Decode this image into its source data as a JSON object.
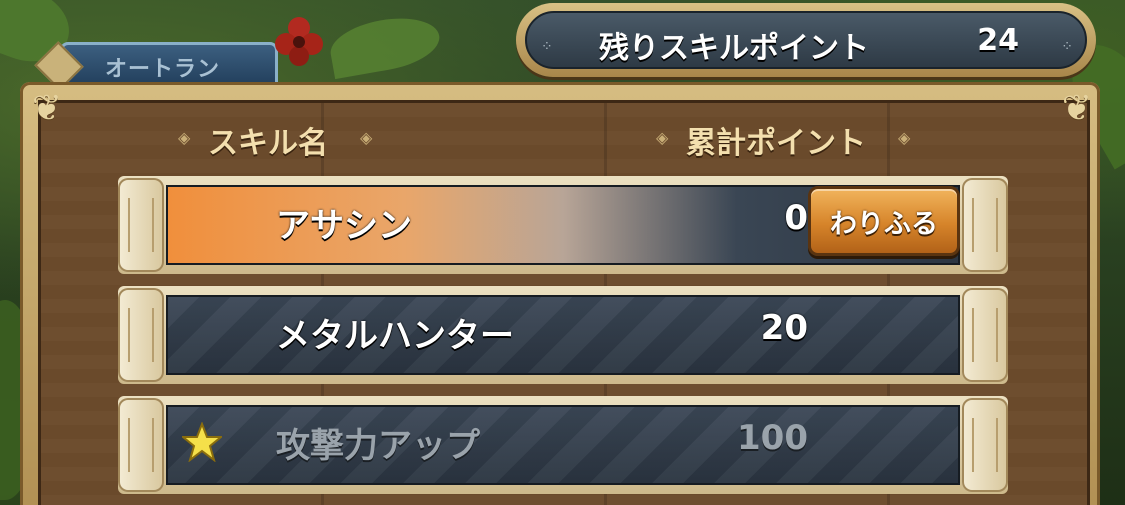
{
  "auto_run_tab": {
    "label": "オートラン"
  },
  "skill_points": {
    "label": "残りスキルポイント",
    "value": "24"
  },
  "table": {
    "header_name": "スキル名",
    "header_points": "累計ポイント"
  },
  "skills": [
    {
      "name": "アサシン",
      "points": "0",
      "selected": true,
      "button_label": "わりふる"
    },
    {
      "name": "メタルハンター",
      "points": "20",
      "selected": false
    },
    {
      "name": "攻撃力アップ",
      "points": "100",
      "selected": false,
      "maxed": true,
      "icon": "star-icon"
    }
  ],
  "colors": {
    "selected_row": "#f08f3c",
    "assign_button": "#d6842a",
    "star": "#f5e04a"
  }
}
